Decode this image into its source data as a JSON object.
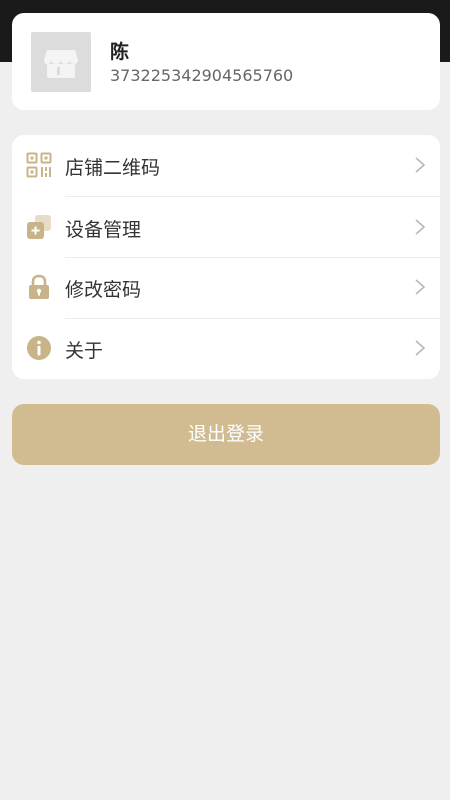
{
  "profile": {
    "name": "陈",
    "id": "373225342904565760",
    "avatar_icon": "store-icon"
  },
  "menu": [
    {
      "label": "店铺二维码",
      "icon": "qr-code-icon"
    },
    {
      "label": "设备管理",
      "icon": "device-manage-icon"
    },
    {
      "label": "修改密码",
      "icon": "lock-icon"
    },
    {
      "label": "关于",
      "icon": "info-icon"
    }
  ],
  "logout_label": "退出登录",
  "colors": {
    "accent": "#d1bb91",
    "icon": "#c9b48a",
    "background": "#efefef"
  }
}
